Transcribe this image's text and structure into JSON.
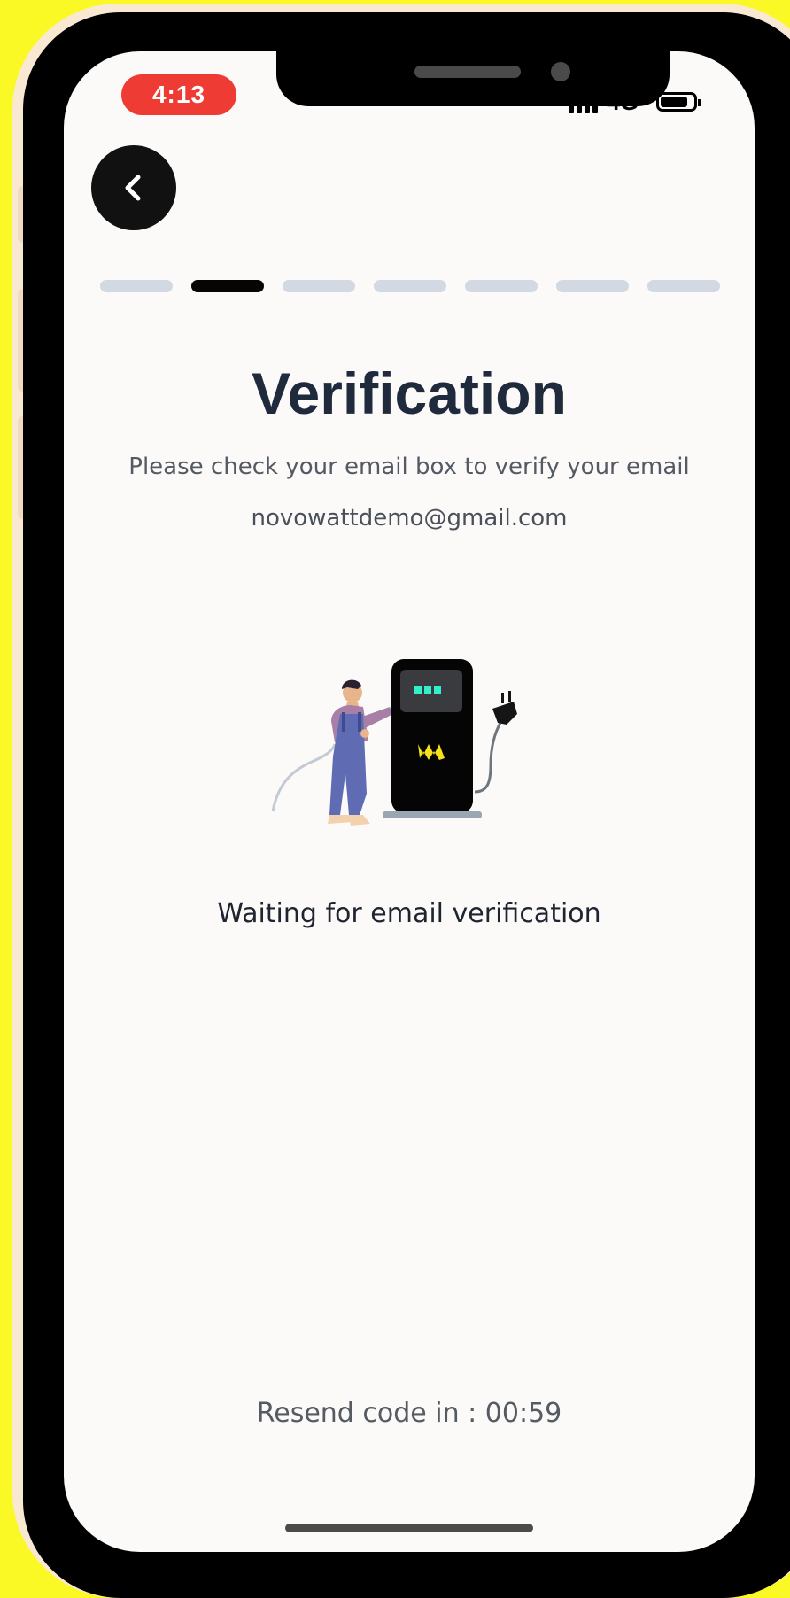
{
  "status_bar": {
    "time": "4:13",
    "network": "4G"
  },
  "progress": {
    "total_steps": 7,
    "current_step": 2
  },
  "page": {
    "title": "Verification",
    "subtitle": "Please check your email box to verify your email",
    "email": "novowattdemo@gmail.com",
    "waiting_text": "Waiting for email verification",
    "resend_text": "Resend code in : 00:59"
  },
  "icons": {
    "back": "chevron-left-icon",
    "illustration": "ev-charger-illustration"
  },
  "colors": {
    "background": "#fbf925",
    "screen": "#fcfaf9",
    "time_pill": "#ee3b34",
    "title": "#1f2a3c",
    "progress_active": "#050505",
    "progress_inactive": "#d3d9e2",
    "charger_logo": "#f5e21a"
  }
}
